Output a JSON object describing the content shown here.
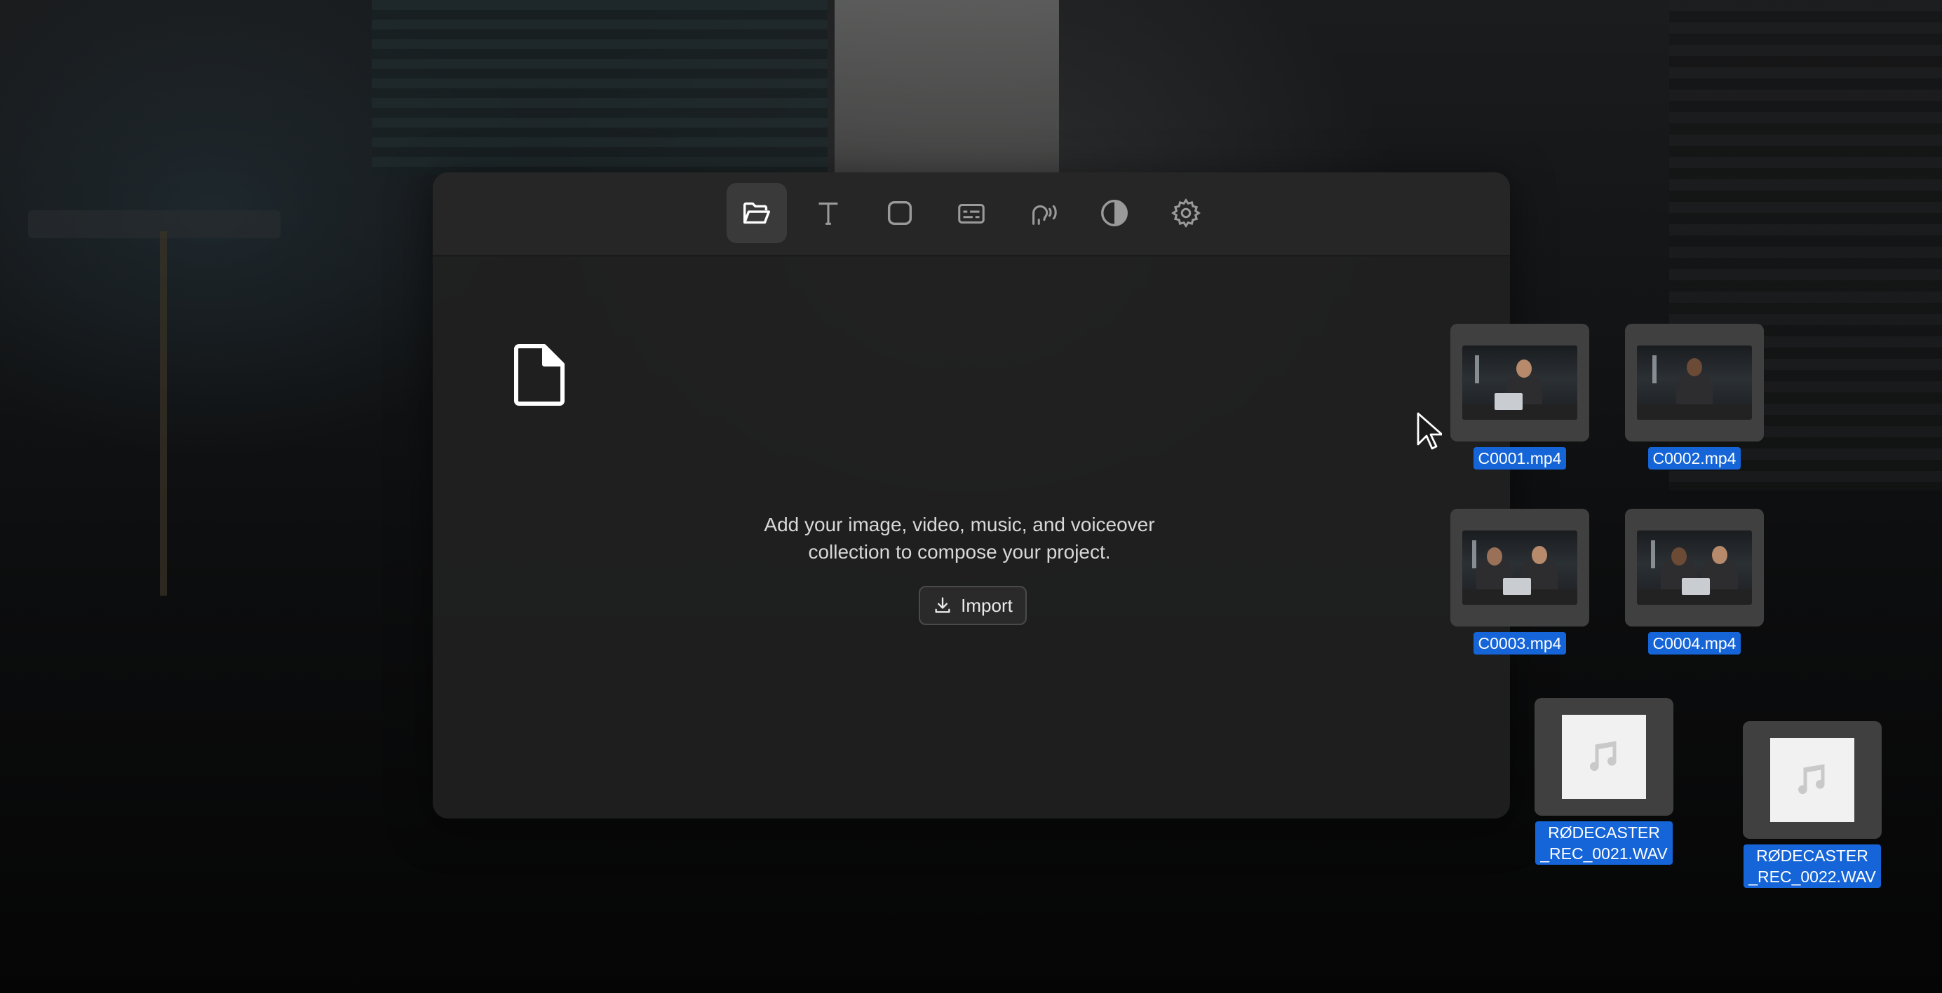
{
  "toolbar": {
    "tools": [
      {
        "id": "media",
        "icon": "folder-open-icon",
        "active": true
      },
      {
        "id": "text",
        "icon": "text-icon",
        "active": false
      },
      {
        "id": "shape",
        "icon": "rounded-square-icon",
        "active": false
      },
      {
        "id": "captions",
        "icon": "captions-icon",
        "active": false
      },
      {
        "id": "voiceover",
        "icon": "voice-icon",
        "active": false
      },
      {
        "id": "adjust",
        "icon": "contrast-icon",
        "active": false
      },
      {
        "id": "settings",
        "icon": "gear-icon",
        "active": false
      }
    ]
  },
  "empty_state": {
    "message_line1": "Add your image, video, music, and voiceover",
    "message_line2": "collection to compose your project.",
    "import_label": "Import"
  },
  "desktop_files": {
    "c0001": "C0001.mp4",
    "c0002": "C0002.mp4",
    "c0003": "C0003.mp4",
    "c0004": "C0004.mp4",
    "rec21_line1": "RØDECASTER",
    "rec21_line2": "_REC_0021.WAV",
    "rec22_line1": "RØDECASTER",
    "rec22_line2": "_REC_0022.WAV"
  },
  "colors": {
    "selection": "#1565d8",
    "panel": "#212121",
    "toolbar": "#262626"
  }
}
